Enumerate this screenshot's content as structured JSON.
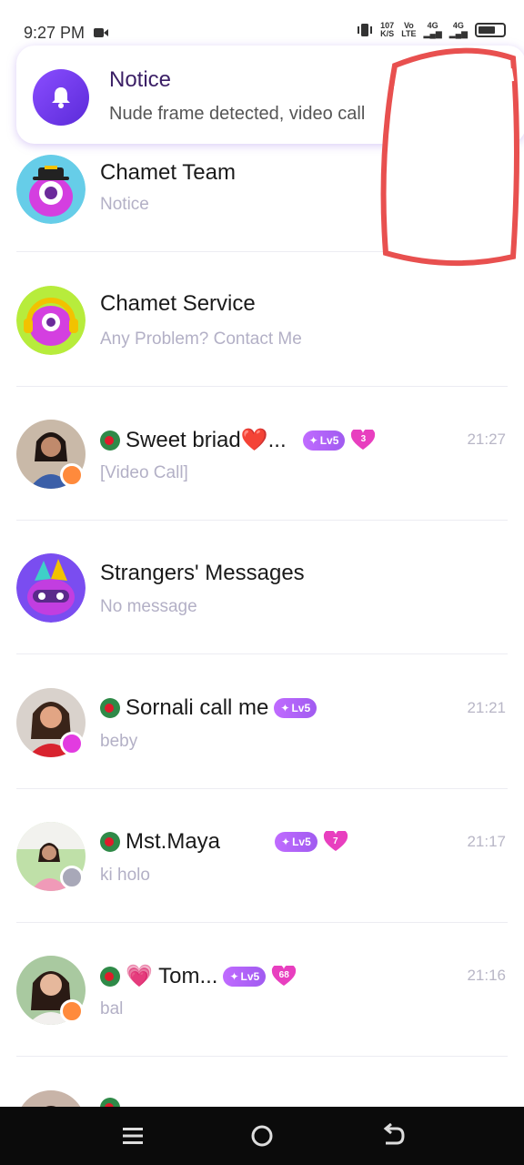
{
  "status_bar": {
    "time": "9:27 PM",
    "net_speed_top": "107",
    "net_speed_bottom": "K/S",
    "volte_top": "Vo",
    "volte_bottom": "LTE",
    "sim1": "4G",
    "sim2": "4G"
  },
  "notice_popup": {
    "title": "Notice",
    "text": "Nude frame detected, video call",
    "icon": "bell-icon"
  },
  "conversations": [
    {
      "name": "Chamet Team",
      "preview": "Notice",
      "time": "",
      "official": true
    },
    {
      "name": "Chamet Service",
      "preview": "Any Problem? Contact Me",
      "time": "",
      "official": true
    },
    {
      "name": "Sweet briad❤️...",
      "preview": "[Video Call]",
      "time": "21:27",
      "level": "Lv5",
      "hearts": "3",
      "status_color": "#ff8a3c"
    },
    {
      "name": "Strangers' Messages",
      "preview": "No message",
      "time": "",
      "official": true
    },
    {
      "name": "Sornali call me",
      "preview": "beby",
      "time": "21:21",
      "level": "Lv5",
      "status_color": "#e23be0"
    },
    {
      "name": "Mst.Maya",
      "preview": "ki holo",
      "time": "21:17",
      "level": "Lv5",
      "hearts": "7",
      "status_color": "#a8a8b8"
    },
    {
      "name": "💗 Tom...",
      "preview": "bal",
      "time": "21:16",
      "level": "Lv5",
      "hearts": "68",
      "status_color": "#ff8a3c"
    }
  ],
  "colors": {
    "accent": "#8a4dff",
    "level_badge": "#b062ff",
    "heart": "#e83fbf",
    "time_text": "#b8b6c6"
  }
}
